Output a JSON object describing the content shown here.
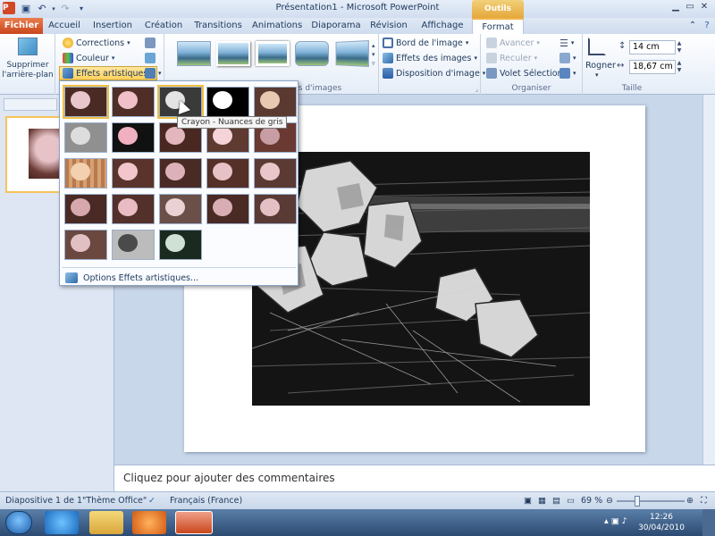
{
  "window": {
    "title": "Présentation1  -  Microsoft PowerPoint",
    "app_icon": "P",
    "context_tab_group": "Outils Image",
    "controls": [
      "minimize",
      "maximize",
      "close"
    ]
  },
  "tabs": [
    {
      "label": "Fichier"
    },
    {
      "label": "Accueil"
    },
    {
      "label": "Insertion"
    },
    {
      "label": "Création"
    },
    {
      "label": "Transitions"
    },
    {
      "label": "Animations"
    },
    {
      "label": "Diaporama"
    },
    {
      "label": "Révision"
    },
    {
      "label": "Affichage"
    },
    {
      "label": "Format"
    }
  ],
  "ribbon": {
    "remove_bg": {
      "label": "Supprimer l'arrière-plan"
    },
    "adjust": {
      "corrections": "Corrections",
      "color": "Couleur",
      "artistic": "Effets artistiques"
    },
    "styles_group_label": "les d'images",
    "image_options": {
      "border": "Bord de l'image",
      "effects": "Effets des images",
      "layout": "Disposition d'image"
    },
    "arrange": {
      "forward": "Avancer",
      "backward": "Reculer",
      "pane": "Volet Sélection",
      "group_label": "Organiser"
    },
    "size": {
      "crop": "Rogner",
      "height": "14 cm",
      "width": "18,67 cm",
      "group_label": "Taille"
    }
  },
  "dropdown": {
    "option_label": "Options Effets artistiques...",
    "tooltip": "Crayon - Nuances de gris"
  },
  "slides_panel": {
    "slide_number": "1"
  },
  "notes": {
    "placeholder": "Cliquez pour ajouter des commentaires"
  },
  "status": {
    "slide_info": "Diapositive 1 de 1",
    "theme": "\"Thème Office\"",
    "language": "Français (France)",
    "zoom": "69 %"
  },
  "taskbar": {
    "time": "12:26",
    "date": "30/04/2010"
  },
  "colors": {
    "accent_file": "#d24726",
    "context_tab": "#f2b24a",
    "selection": "#ffd25c"
  }
}
